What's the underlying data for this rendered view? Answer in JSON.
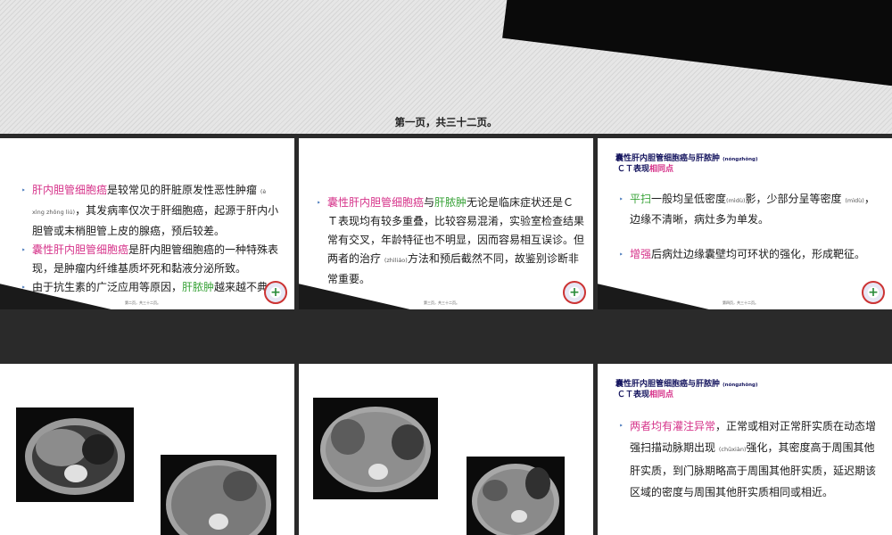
{
  "cover": {
    "caption": "第一页，共三十二页。"
  },
  "slide1": {
    "p1_term": "肝内胆管细胞癌",
    "p1_text": "是较常见的肝脏原发性恶性肿瘤",
    "p1_ruby": "(è xìng zhǒng liú)",
    "p1_rest": "，其发病率仅次于肝细胞癌，起源于肝内小胆管或末梢胆管上皮的腺癌，预后较差。",
    "p2_term": "囊性肝内胆管细胞癌",
    "p2_text": "是肝内胆管细胞癌的一种特殊表现，是肿瘤内纤维基质坏死和黏液分泌所致。",
    "p3_text": "由于抗生素的广泛应用等原因，",
    "p3_term": "肝脓肿",
    "p3_rest": "越来越不典型。"
  },
  "slide2": {
    "term1": "囊性肝内胆管细胞癌",
    "conj": "与",
    "term2": "肝脓肿",
    "text1": "无论是临床症状还是ＣＴ表现均有较多重叠，比较容易混淆，实验室检查结果常有交叉，年龄特征也不明显，因而容易相互误诊。但两者的治疗",
    "ruby": "(zhìliáo)",
    "text2": "方法和预后截然不同，故鉴别诊断非常重要。"
  },
  "slide3": {
    "title_main": "囊性肝内胆管细胞癌与肝脓肿",
    "title_ruby": "(nóngzhǒng)",
    "title_ct": "ＣＴ表现",
    "title_hl": "相同点",
    "p1_term": "平扫",
    "p1_text": "一般均呈低密度",
    "p1_ruby1": "(mìdù)",
    "p1_text2": "影，少部分呈等密度",
    "p1_ruby2": "(mìdù)",
    "p1_rest": "，边缘不清晰，病灶多为单发。",
    "p2_term": "增强",
    "p2_text": "后病灶边缘囊壁均可环状的强化，形成靶征。"
  },
  "slide6": {
    "title_main": "囊性肝内胆管细胞癌与肝脓肿",
    "title_ruby": "(nóngzhǒng)",
    "title_ct": "ＣＴ表现",
    "title_hl": "相同点",
    "p1_term": "两者均有灌注异常",
    "p1_text": "，正常或相对正常肝实质在动态增强扫描动脉期出现",
    "p1_ruby": "(chūxiàn)",
    "p1_rest": "强化，其密度高于周围其他肝实质，到门脉期略高于周围其他肝实质，延迟期该区域的密度与周围其他肝实质相同或相近。"
  },
  "footers": {
    "s1": "第二页，共三十二页。",
    "s2": "第三页，共三十二页。",
    "s3": "第四页，共三十二页。"
  },
  "colors": {
    "term_pink": "#d6338a",
    "term_green": "#3aa33a",
    "title_navy": "#14145e",
    "bullet_blue": "#3b6fb6"
  }
}
